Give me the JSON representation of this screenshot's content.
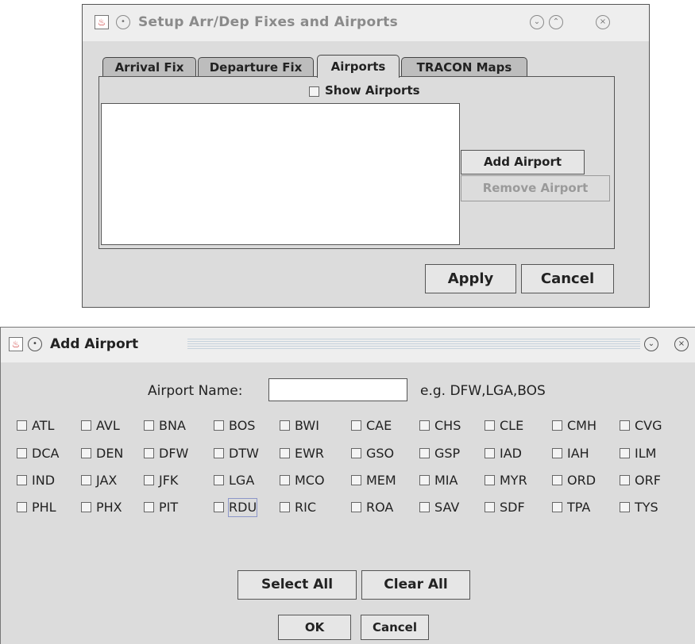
{
  "setup_dialog": {
    "title": "Setup Arr/Dep Fixes and Airports",
    "tabs": [
      {
        "label": "Arrival Fix"
      },
      {
        "label": "Departure Fix"
      },
      {
        "label": "Airports",
        "active": true
      },
      {
        "label": "TRACON Maps"
      }
    ],
    "show_airports_label": "Show Airports",
    "add_airport_label": "Add Airport",
    "remove_airport_label": "Remove Airport",
    "apply_label": "Apply",
    "cancel_label": "Cancel"
  },
  "add_dialog": {
    "title": "Add Airport",
    "airport_name_label": "Airport Name:",
    "airport_name_value": "",
    "example_text": "e.g. DFW,LGA,BOS",
    "airports": [
      [
        "ATL",
        "AVL",
        "BNA",
        "BOS",
        "BWI",
        "CAE",
        "CHS",
        "CLE",
        "CMH",
        "CVG"
      ],
      [
        "DCA",
        "DEN",
        "DFW",
        "DTW",
        "EWR",
        "GSO",
        "GSP",
        "IAD",
        "IAH",
        "ILM"
      ],
      [
        "IND",
        "JAX",
        "JFK",
        "LGA",
        "MCO",
        "MEM",
        "MIA",
        "MYR",
        "ORD",
        "ORF"
      ],
      [
        "PHL",
        "PHX",
        "PIT",
        "RDU",
        "RIC",
        "ROA",
        "SAV",
        "SDF",
        "TPA",
        "TYS"
      ]
    ],
    "select_all_label": "Select All",
    "clear_all_label": "Clear All",
    "ok_label": "OK",
    "cancel_label": "Cancel"
  },
  "icons": {
    "app_icon": "java-cup-icon",
    "menu": "window-menu-icon",
    "minimize": "minimize-icon",
    "maximize": "maximize-icon",
    "close": "close-icon"
  }
}
